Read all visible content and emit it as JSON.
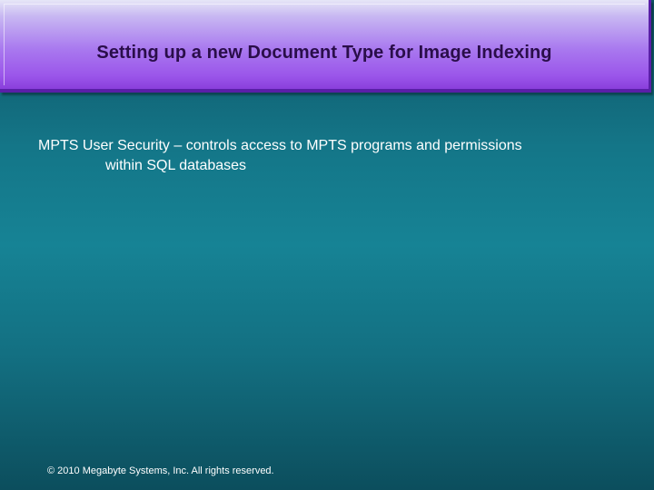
{
  "slide": {
    "title": "Setting up a new Document Type for Image Indexing",
    "body": {
      "line1": "MPTS User Security – controls access to MPTS programs and permissions",
      "line2": "within SQL databases"
    },
    "footer": "© 2010 Megabyte Systems, Inc. All rights reserved."
  },
  "colors": {
    "title_bar": "#a979ef",
    "title_text": "#2a0e4a",
    "background": "#168395",
    "body_text": "#ffffff"
  }
}
